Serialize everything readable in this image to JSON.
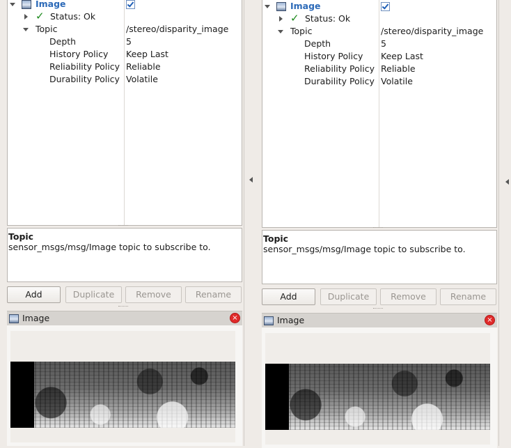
{
  "panes": [
    {
      "display_name": "Image",
      "status": "Status: Ok",
      "topic_label": "Topic",
      "topic_value": "/stereo/disparity_image",
      "depth_label": "Depth",
      "depth_value": "5",
      "history_label": "History Policy",
      "history_value": "Keep Last",
      "reliability_label": "Reliability Policy",
      "reliability_value": "Reliable",
      "durability_label": "Durability Policy",
      "durability_value": "Volatile",
      "desc_title": "Topic",
      "desc_text": "sensor_msgs/msg/Image topic to subscribe to.",
      "buttons": {
        "add": "Add",
        "duplicate": "Duplicate",
        "remove": "Remove",
        "rename": "Rename"
      },
      "panel_title": "Image",
      "close_glyph": "×"
    },
    {
      "display_name": "Image",
      "status": "Status: Ok",
      "topic_label": "Topic",
      "topic_value": "/stereo/disparity_image",
      "depth_label": "Depth",
      "depth_value": "5",
      "history_label": "History Policy",
      "history_value": "Keep Last",
      "reliability_label": "Reliability Policy",
      "reliability_value": "Reliable",
      "durability_label": "Durability Policy",
      "durability_value": "Volatile",
      "desc_title": "Topic",
      "desc_text": "sensor_msgs/msg/Image topic to subscribe to.",
      "buttons": {
        "add": "Add",
        "duplicate": "Duplicate",
        "remove": "Remove",
        "rename": "Rename"
      },
      "panel_title": "Image",
      "close_glyph": "×"
    }
  ],
  "icons": {
    "expand": "expand-arrow-icon",
    "collapse": "collapse-arrow-icon",
    "image": "image-display-icon",
    "check": "checkbox-checked-icon",
    "ok": "status-ok-icon",
    "close": "close-icon"
  },
  "colors": {
    "accent_text": "#2c6ab8",
    "ok_green": "#1c8a1c",
    "close_red": "#e02a2a",
    "window_bg": "#efebe7"
  },
  "checkbox_checked": true
}
